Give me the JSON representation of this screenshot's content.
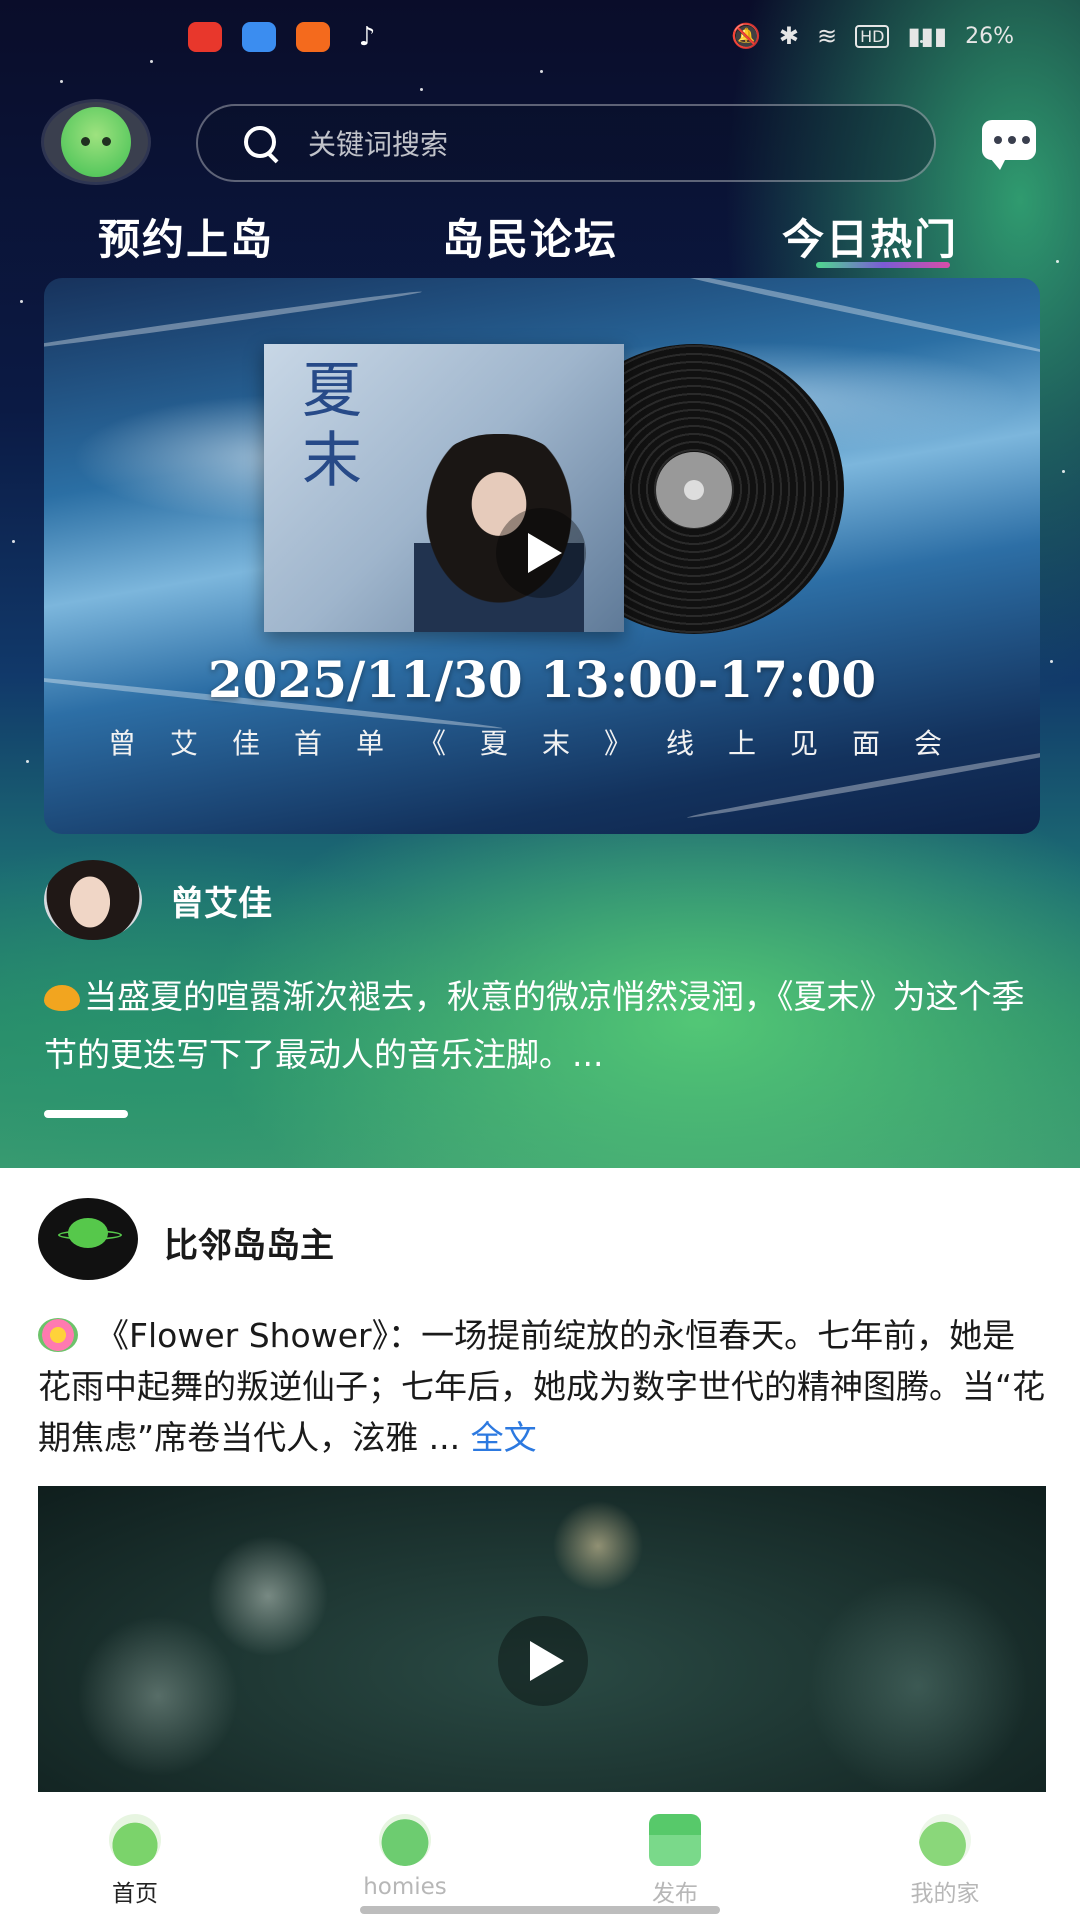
{
  "status_bar": {
    "app_icons": [
      "youtube-app-icon",
      "messages-app-icon",
      "orange-app-icon",
      "tiktok-app-icon"
    ],
    "battery": "26%",
    "network_badge": "HD"
  },
  "header": {
    "search_placeholder": "关键词搜索"
  },
  "tabs": [
    {
      "label": "预约上岛",
      "active": false
    },
    {
      "label": "岛民论坛",
      "active": false
    },
    {
      "label": "今日热门",
      "active": true
    }
  ],
  "banner": {
    "album_title": "夏末",
    "date_time": "2025/11/30  13:00-17:00",
    "subtitle": "曾艾佳首单《夏末》线上见面会"
  },
  "post1": {
    "author": "曾艾佳",
    "text": "当盛夏的喧嚣渐次褪去，秋意的微凉悄然浸润，《夏末》为这个季节的更迭写下了最动人的音乐注脚。..."
  },
  "post2": {
    "author": "比邻岛岛主",
    "text": "《Flower Shower》：一场提前绽放的永恒春天。七年前，她是花雨中起舞的叛逆仙子；七年后，她成为数字世代的精神图腾。当“花期焦虑”席卷当代人，泫雅 ...",
    "more_label": "全文"
  },
  "bottom_nav": [
    {
      "label": "首页",
      "icon": "home-mascot-icon",
      "active": true
    },
    {
      "label": "homies",
      "icon": "homies-mascot-icon",
      "active": false
    },
    {
      "label": "发布",
      "icon": "publish-gift-icon",
      "active": false
    },
    {
      "label": "我的家",
      "icon": "my-home-mascot-icon",
      "active": false
    }
  ],
  "colors": {
    "tab_underline": [
      "#4fd98e",
      "#7b5bd6",
      "#d84ea8"
    ],
    "link": "#2c79e0",
    "nav_active": "#222222",
    "nav_inactive": "#b7b7b7"
  }
}
